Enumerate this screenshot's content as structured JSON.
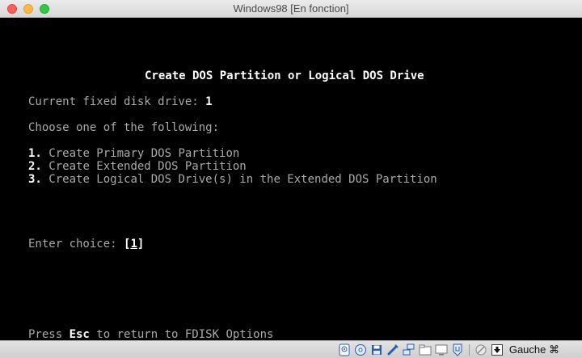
{
  "window": {
    "title": "Windows98 [En fonction]"
  },
  "screen": {
    "heading": "Create DOS Partition or Logical DOS Drive",
    "drive_label": "Current fixed disk drive: ",
    "drive_value": "1",
    "prompt_intro": "Choose one of the following:",
    "options": [
      {
        "number": "1.",
        "label": "Create Primary DOS Partition"
      },
      {
        "number": "2.",
        "label": "Create Extended DOS Partition"
      },
      {
        "number": "3.",
        "label": "Create Logical DOS Drive(s) in the Extended DOS Partition"
      }
    ],
    "choice_label": "Enter choice: ",
    "choice_open": "[",
    "choice_value": "1",
    "choice_close": "]",
    "footer_prefix": "Press ",
    "footer_key": "Esc",
    "footer_suffix": " to return to FDISK Options"
  },
  "statusbar": {
    "icons": [
      "hard-disk-icon",
      "optical-drive-icon",
      "floppy-icon",
      "usb-icon",
      "network-icon",
      "shared-folder-icon",
      "display-icon",
      "video-capture-icon",
      "cpu-icon",
      "mouse-integration-icon"
    ],
    "host_key": "Gauche ⌘"
  },
  "colors": {
    "screen_bg": "#000000",
    "text_normal": "#aaaaaa",
    "text_bright": "#ffffff",
    "close": "#fc605b",
    "minimize": "#fdbc40",
    "maximize": "#34c84a"
  }
}
